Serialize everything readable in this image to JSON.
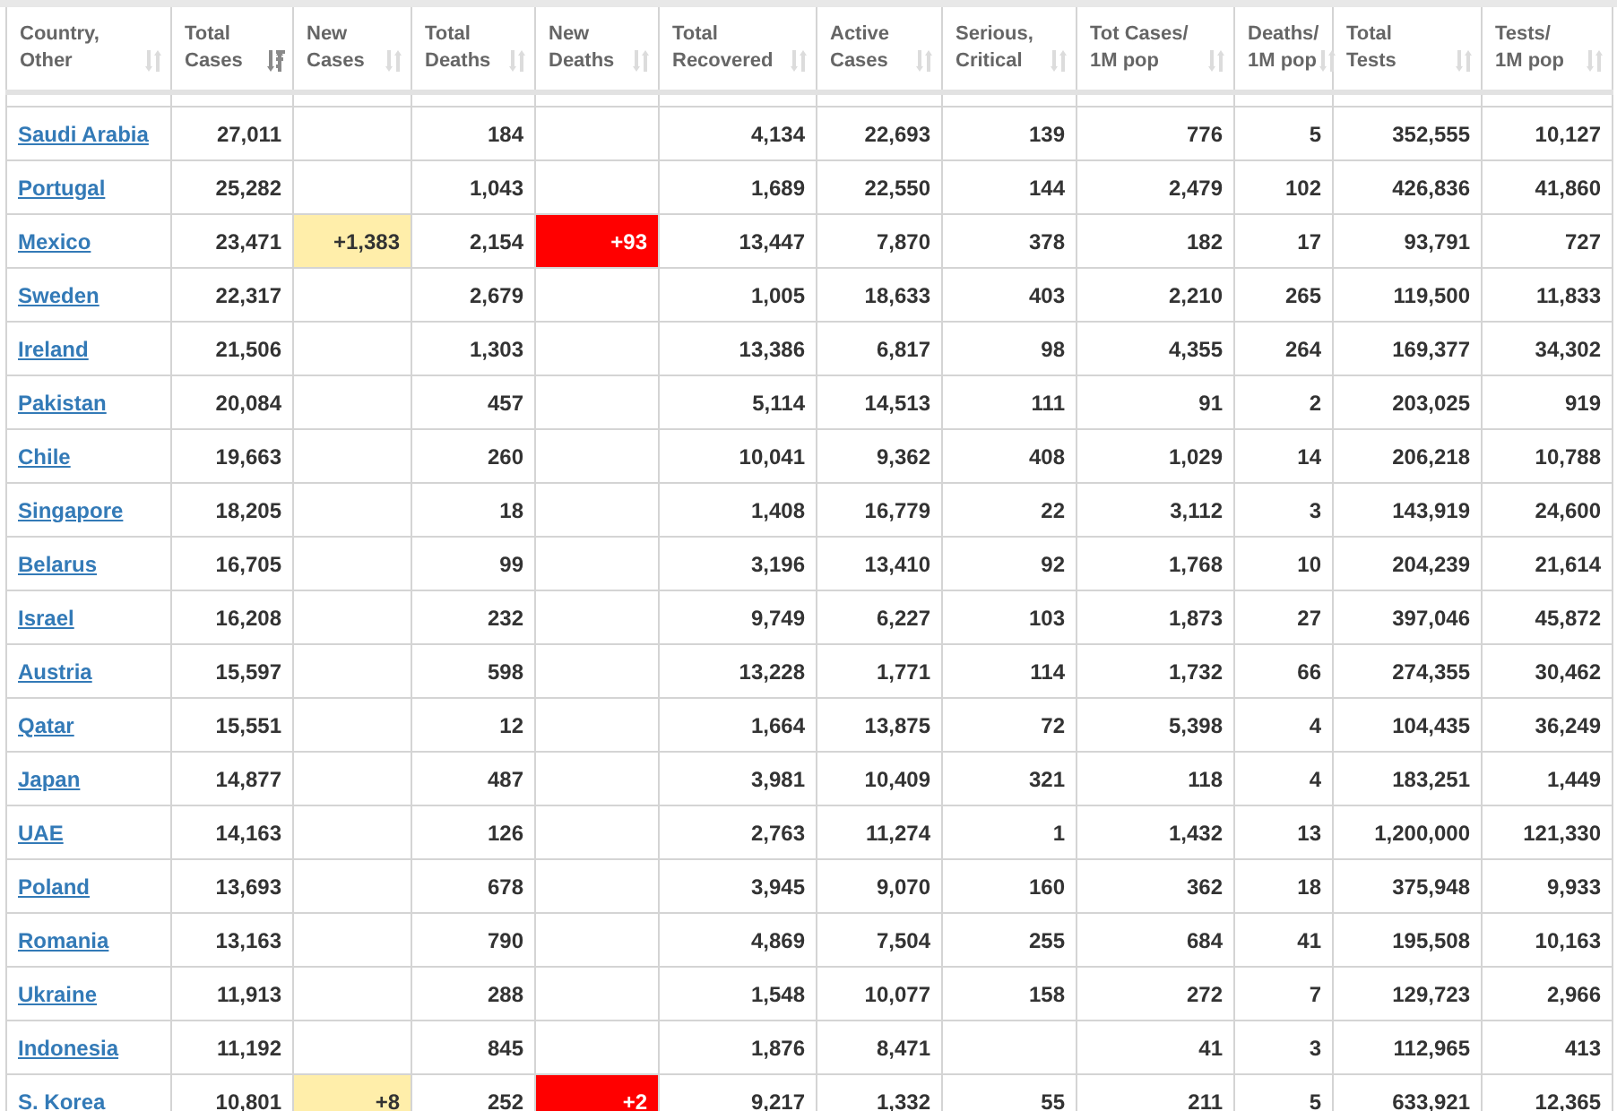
{
  "table": {
    "columns": [
      {
        "label": "Country,\nOther",
        "kind": "country",
        "sorted": false
      },
      {
        "label": "Total\nCases",
        "kind": "number",
        "sorted": true
      },
      {
        "label": "New\nCases",
        "kind": "new_cases",
        "sorted": false
      },
      {
        "label": "Total\nDeaths",
        "kind": "number",
        "sorted": false
      },
      {
        "label": "New\nDeaths",
        "kind": "new_deaths",
        "sorted": false
      },
      {
        "label": "Total\nRecovered",
        "kind": "number",
        "sorted": false
      },
      {
        "label": "Active\nCases",
        "kind": "number",
        "sorted": false
      },
      {
        "label": "Serious,\nCritical",
        "kind": "number",
        "sorted": false
      },
      {
        "label": "Tot Cases/\n1M pop",
        "kind": "number",
        "sorted": false
      },
      {
        "label": "Deaths/\n1M pop",
        "kind": "number",
        "sorted": false
      },
      {
        "label": "Total\nTests",
        "kind": "number",
        "sorted": false
      },
      {
        "label": "Tests/\n1M pop",
        "kind": "number",
        "sorted": false
      }
    ],
    "rows": [
      [
        "Saudi Arabia",
        "27,011",
        null,
        "184",
        null,
        "4,134",
        "22,693",
        "139",
        "776",
        "5",
        "352,555",
        "10,127"
      ],
      [
        "Portugal",
        "25,282",
        null,
        "1,043",
        null,
        "1,689",
        "22,550",
        "144",
        "2,479",
        "102",
        "426,836",
        "41,860"
      ],
      [
        "Mexico",
        "23,471",
        "+1,383",
        "2,154",
        "+93",
        "13,447",
        "7,870",
        "378",
        "182",
        "17",
        "93,791",
        "727"
      ],
      [
        "Sweden",
        "22,317",
        null,
        "2,679",
        null,
        "1,005",
        "18,633",
        "403",
        "2,210",
        "265",
        "119,500",
        "11,833"
      ],
      [
        "Ireland",
        "21,506",
        null,
        "1,303",
        null,
        "13,386",
        "6,817",
        "98",
        "4,355",
        "264",
        "169,377",
        "34,302"
      ],
      [
        "Pakistan",
        "20,084",
        null,
        "457",
        null,
        "5,114",
        "14,513",
        "111",
        "91",
        "2",
        "203,025",
        "919"
      ],
      [
        "Chile",
        "19,663",
        null,
        "260",
        null,
        "10,041",
        "9,362",
        "408",
        "1,029",
        "14",
        "206,218",
        "10,788"
      ],
      [
        "Singapore",
        "18,205",
        null,
        "18",
        null,
        "1,408",
        "16,779",
        "22",
        "3,112",
        "3",
        "143,919",
        "24,600"
      ],
      [
        "Belarus",
        "16,705",
        null,
        "99",
        null,
        "3,196",
        "13,410",
        "92",
        "1,768",
        "10",
        "204,239",
        "21,614"
      ],
      [
        "Israel",
        "16,208",
        null,
        "232",
        null,
        "9,749",
        "6,227",
        "103",
        "1,873",
        "27",
        "397,046",
        "45,872"
      ],
      [
        "Austria",
        "15,597",
        null,
        "598",
        null,
        "13,228",
        "1,771",
        "114",
        "1,732",
        "66",
        "274,355",
        "30,462"
      ],
      [
        "Qatar",
        "15,551",
        null,
        "12",
        null,
        "1,664",
        "13,875",
        "72",
        "5,398",
        "4",
        "104,435",
        "36,249"
      ],
      [
        "Japan",
        "14,877",
        null,
        "487",
        null,
        "3,981",
        "10,409",
        "321",
        "118",
        "4",
        "183,251",
        "1,449"
      ],
      [
        "UAE",
        "14,163",
        null,
        "126",
        null,
        "2,763",
        "11,274",
        "1",
        "1,432",
        "13",
        "1,200,000",
        "121,330"
      ],
      [
        "Poland",
        "13,693",
        null,
        "678",
        null,
        "3,945",
        "9,070",
        "160",
        "362",
        "18",
        "375,948",
        "9,933"
      ],
      [
        "Romania",
        "13,163",
        null,
        "790",
        null,
        "4,869",
        "7,504",
        "255",
        "684",
        "41",
        "195,508",
        "10,163"
      ],
      [
        "Ukraine",
        "11,913",
        null,
        "288",
        null,
        "1,548",
        "10,077",
        "158",
        "272",
        "7",
        "129,723",
        "2,966"
      ],
      [
        "Indonesia",
        "11,192",
        null,
        "845",
        null,
        "1,876",
        "8,471",
        null,
        "41",
        "3",
        "112,965",
        "413"
      ],
      [
        "S. Korea",
        "10,801",
        "+8",
        "252",
        "+2",
        "9,217",
        "1,332",
        "55",
        "211",
        "5",
        "633,921",
        "12,365"
      ]
    ]
  }
}
